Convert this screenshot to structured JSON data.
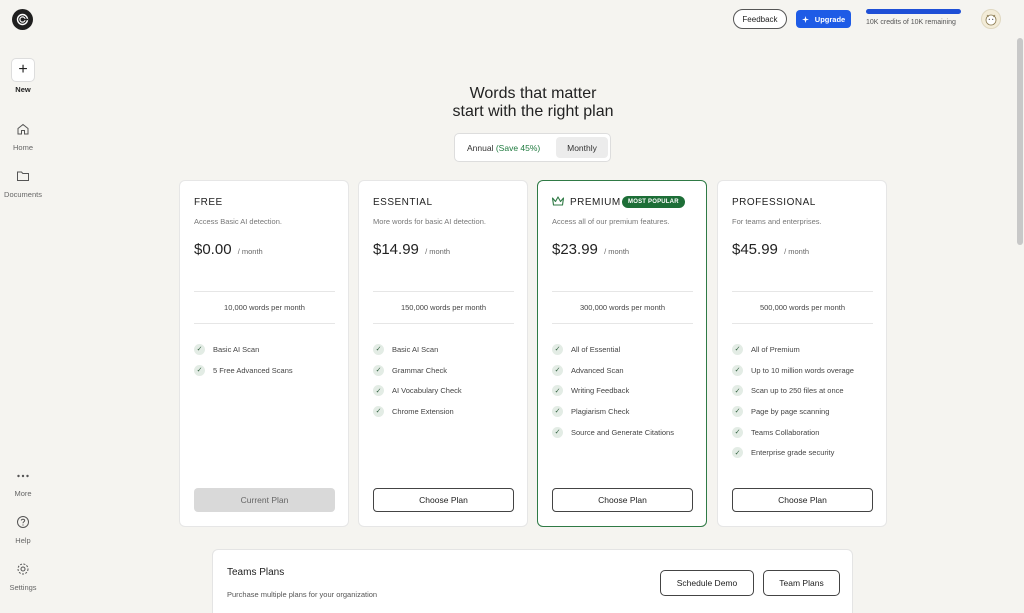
{
  "sidebar": {
    "new_label": "New",
    "items": [
      {
        "label": "Home",
        "icon": "home-icon"
      },
      {
        "label": "Documents",
        "icon": "folder-icon"
      },
      {
        "label": "More",
        "icon": "more-icon"
      },
      {
        "label": "Help",
        "icon": "help-icon"
      },
      {
        "label": "Settings",
        "icon": "settings-icon"
      }
    ]
  },
  "topbar": {
    "feedback_label": "Feedback",
    "upgrade_label": "Upgrade",
    "credits_text": "10K credits of 10K remaining",
    "credits_fraction": 1.0
  },
  "heading": {
    "line1": "Words that matter",
    "line2": "start with the right plan"
  },
  "billing_toggle": {
    "annual_label": "Annual",
    "annual_save": "(Save 45%)",
    "monthly_label": "Monthly",
    "selected": "Monthly"
  },
  "plans": [
    {
      "name": "FREE",
      "description": "Access Basic AI detection.",
      "price": "$0.00",
      "period": "/ month",
      "words": "10,000 words per month",
      "features": [
        "Basic AI Scan",
        "5 Free Advanced Scans"
      ],
      "button": "Current Plan"
    },
    {
      "name": "ESSENTIAL",
      "description": "More words for basic AI detection.",
      "price": "$14.99",
      "period": "/ month",
      "words": "150,000 words per month",
      "features": [
        "Basic AI Scan",
        "Grammar Check",
        "AI Vocabulary Check",
        "Chrome Extension"
      ],
      "button": "Choose Plan"
    },
    {
      "name": "PREMIUM",
      "badge": "MOST POPULAR",
      "description": "Access all of our premium features.",
      "price": "$23.99",
      "period": "/ month",
      "words": "300,000 words per month",
      "features": [
        "All of Essential",
        "Advanced Scan",
        "Writing Feedback",
        "Plagiarism Check",
        "Source and Generate Citations"
      ],
      "button": "Choose Plan"
    },
    {
      "name": "PROFESSIONAL",
      "description": "For teams and enterprises.",
      "price": "$45.99",
      "period": "/ month",
      "words": "500,000 words per month",
      "features": [
        "All of Premium",
        "Up to 10 million words overage",
        "Scan up to 250 files at once",
        "Page by page scanning",
        "Teams Collaboration",
        "Enterprise grade security"
      ],
      "button": "Choose Plan"
    }
  ],
  "teams": {
    "title": "Teams Plans",
    "subtitle": "Purchase multiple plans for your organization",
    "demo_button": "Schedule Demo",
    "plans_button": "Team Plans"
  },
  "colors": {
    "accent": "#1e5be6",
    "premium_border": "#2f7a45",
    "badge": "#1d6e37",
    "save_text": "#1e7a3e"
  }
}
